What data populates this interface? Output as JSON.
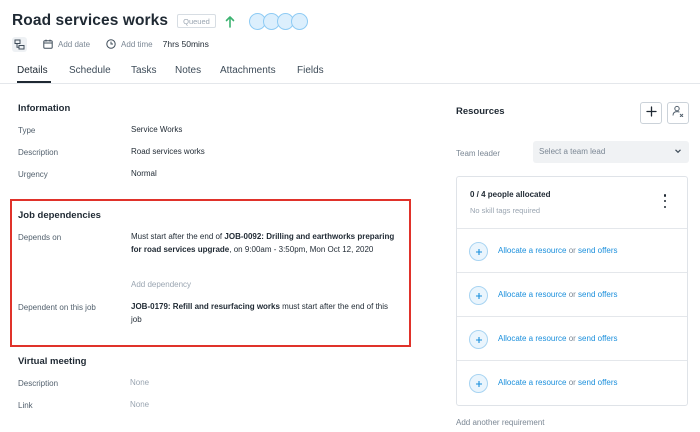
{
  "header": {
    "title": "Road services works",
    "status": "Queued",
    "add_date": "Add date",
    "add_time": "Add time",
    "duration": "7hrs 50mins"
  },
  "tabs": [
    "Details",
    "Schedule",
    "Tasks",
    "Notes",
    "Attachments",
    "Fields"
  ],
  "information": {
    "title": "Information",
    "rows": [
      {
        "label": "Type",
        "value": "Service Works"
      },
      {
        "label": "Description",
        "value": "Road services works"
      },
      {
        "label": "Urgency",
        "value": "Normal"
      }
    ]
  },
  "job_dependencies": {
    "title": "Job dependencies",
    "depends_on_label": "Depends on",
    "depends_on": {
      "prefix": "Must start after the end of ",
      "job": "JOB-0092: Drilling and earthworks preparing for road services upgrade",
      "suffix_line": ", on 9:00am - 3:50pm, Mon Oct",
      "date_tail": "12, 2020"
    },
    "add_dependency": "Add dependency",
    "dependent_label": "Dependent on this job",
    "dependent": {
      "job": "JOB-0179: Refill and resurfacing works",
      "suffix": " must start after the end of",
      "tail": "this job"
    }
  },
  "virtual_meeting": {
    "title": "Virtual meeting",
    "rows": [
      {
        "label": "Description",
        "value": "None"
      },
      {
        "label": "Link",
        "value": "None"
      }
    ]
  },
  "resources": {
    "title": "Resources",
    "team_leader_label": "Team leader",
    "team_leader_placeholder": "Select a team lead",
    "allocated": "0 / 4 people allocated",
    "skill_tags": "No skill tags required",
    "allocate_link": "Allocate a resource",
    "or_text": " or ",
    "send_offers": "send offers",
    "add_requirement": "Add another requirement"
  },
  "colors": {
    "highlight": "#e0322a",
    "link": "#1a8fdc",
    "status_up": "#3cb371"
  }
}
